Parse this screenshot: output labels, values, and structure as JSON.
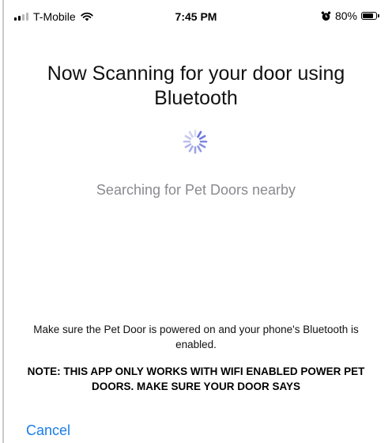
{
  "status_bar": {
    "carrier": "T-Mobile",
    "time": "7:45 PM",
    "battery": "80%",
    "battery_level": 0.8,
    "signal_icon": "cellular-signal-icon",
    "wifi_icon": "wifi-icon",
    "alarm_icon": "alarm-icon",
    "battery_icon": "battery-icon"
  },
  "main": {
    "title": "Now Scanning for your door using Bluetooth",
    "spinner_icon": "activity-spinner-icon",
    "searching_text": "Searching for Pet Doors nearby",
    "hint": "Make sure the Pet Door is powered on and your phone's Bluetooth is enabled.",
    "note": "NOTE: THIS APP ONLY WORKS WITH WIFI ENABLED POWER PET DOORS. MAKE SURE YOUR DOOR SAYS"
  },
  "footer": {
    "cancel_label": "Cancel"
  },
  "colors": {
    "accent": "#1a7ee8",
    "spinner": "#6b72d8",
    "secondary_text": "#8a8a8f"
  }
}
